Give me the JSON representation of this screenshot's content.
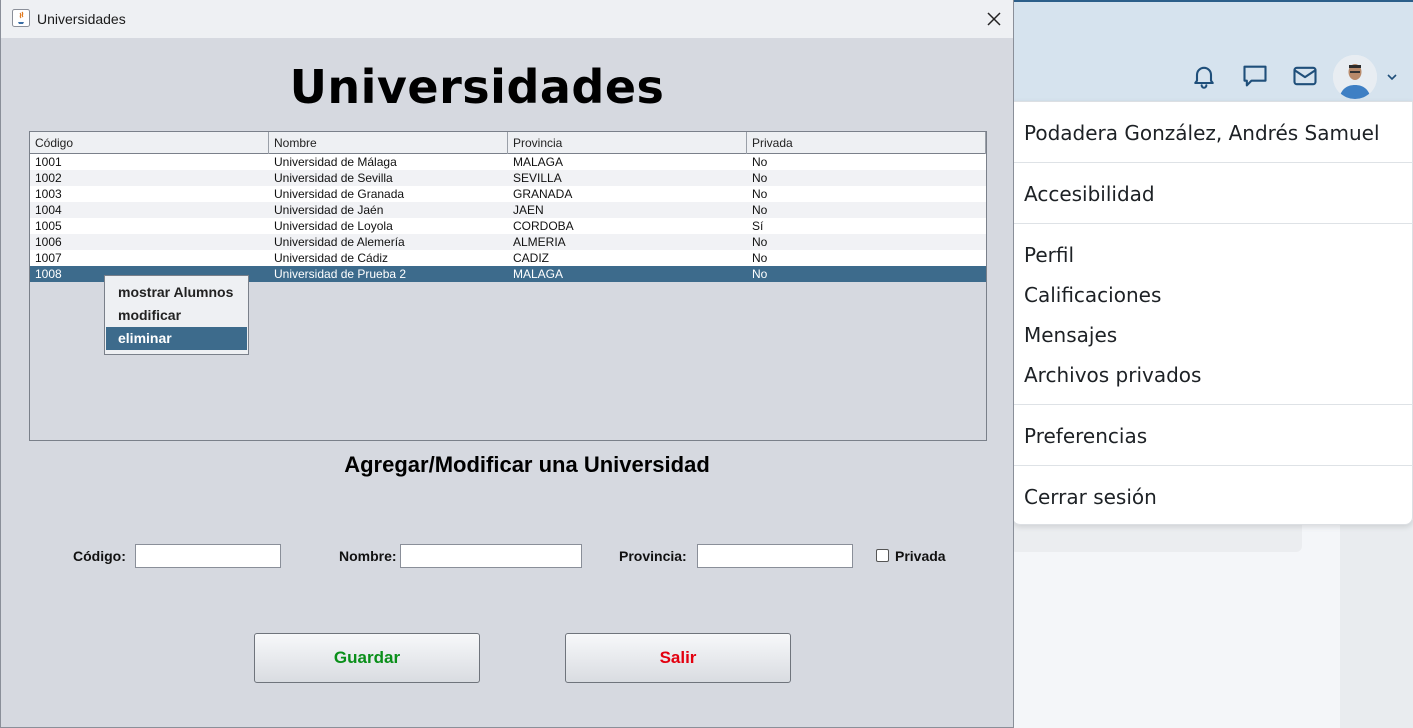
{
  "window": {
    "title": "Universidades",
    "heading": "Universidades",
    "table": {
      "columns": [
        "Código",
        "Nombre",
        "Provincia",
        "Privada"
      ],
      "rows": [
        [
          "1001",
          "Universidad de Málaga",
          "MALAGA",
          "No"
        ],
        [
          "1002",
          "Universidad de Sevilla",
          "SEVILLA",
          "No"
        ],
        [
          "1003",
          "Universidad de Granada",
          "GRANADA",
          "No"
        ],
        [
          "1004",
          "Universidad de Jaén",
          "JAEN",
          "No"
        ],
        [
          "1005",
          "Universidad de Loyola",
          "CORDOBA",
          "Sí"
        ],
        [
          "1006",
          "Universidad de Alemería",
          "ALMERIA",
          "No"
        ],
        [
          "1007",
          "Universidad de Cádiz",
          "CADIZ",
          "No"
        ],
        [
          "1008",
          "Universidad de Prueba 2",
          "MALAGA",
          "No"
        ]
      ],
      "selected_row": 7
    },
    "context_menu": {
      "items": [
        "mostrar Alumnos",
        "modificar",
        "eliminar"
      ],
      "active_index": 2
    },
    "form": {
      "title": "Agregar/Modificar una Universidad",
      "codigo_label": "Código:",
      "codigo_value": "",
      "nombre_label": "Nombre:",
      "nombre_value": "",
      "provincia_label": "Provincia:",
      "provincia_value": "",
      "privada_label": "Privada",
      "privada_checked": false
    },
    "buttons": {
      "guardar": "Guardar",
      "salir": "Salir"
    },
    "colors": {
      "guardar_text": "#0a8f1a",
      "salir_text": "#e3000f",
      "selection": "#3d6b8c"
    }
  },
  "user_menu": {
    "user_name": "Podadera González, Andrés Samuel",
    "accesibilidad": "Accesibilidad",
    "items": [
      "Perfil",
      "Calificaciones",
      "Mensajes",
      "Archivos privados"
    ],
    "preferencias": "Preferencias",
    "logout": "Cerrar sesión"
  },
  "header_icons": [
    "bell-icon",
    "chat-icon",
    "mail-icon"
  ]
}
